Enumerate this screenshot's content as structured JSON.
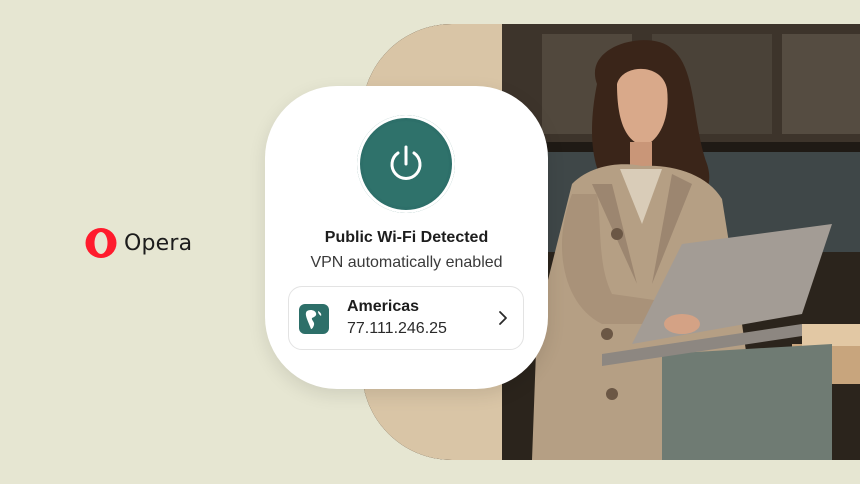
{
  "brand": {
    "name": "Opera",
    "color": "#ff1b2d"
  },
  "vpn_card": {
    "title": "Public Wi-Fi Detected",
    "subtitle": "VPN automatically enabled",
    "accent_color": "#2d6f69",
    "power_icon": "power-icon",
    "location": {
      "region": "Americas",
      "ip": "77.111.246.25",
      "icon": "globe-americas-icon",
      "action_icon": "chevron-right-icon"
    }
  },
  "photo": {
    "description_icon": "photo-woman-laptop"
  },
  "colors": {
    "background": "#e6e6d2",
    "card": "#ffffff"
  }
}
